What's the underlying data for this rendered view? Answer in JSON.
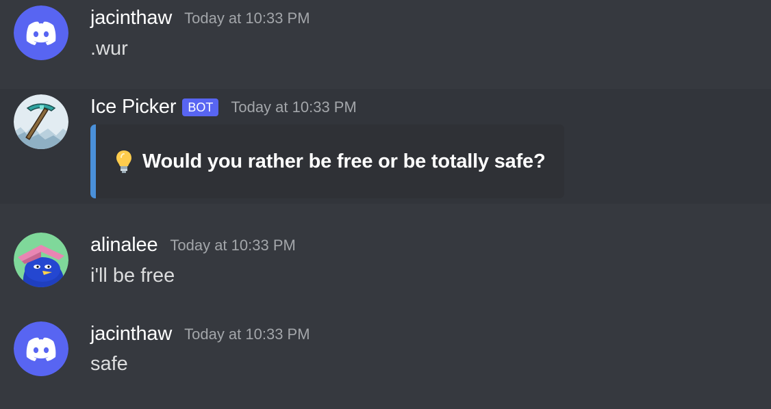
{
  "messages": [
    {
      "username": "jacinthaw",
      "timestamp": "Today at 10:33 PM",
      "avatar": "discord-logo-icon",
      "text": ".wur"
    },
    {
      "username": "Ice Picker",
      "tag": "BOT",
      "timestamp": "Today at 10:33 PM",
      "avatar": "pickaxe-icon",
      "embed": {
        "icon": "lightbulb-icon",
        "title": "Would you rather be free or be totally safe?",
        "color": "#4a90d9"
      }
    },
    {
      "username": "alinalee",
      "timestamp": "Today at 10:33 PM",
      "avatar": "cartoon-character-avatar",
      "text": "i'll be free"
    },
    {
      "username": "jacinthaw",
      "timestamp": "Today at 10:33 PM",
      "avatar": "discord-logo-icon",
      "text": "safe"
    }
  ],
  "colors": {
    "background": "#36393f",
    "highlight": "#32353b",
    "discord_blurple": "#5865f2",
    "username": "#ffffff",
    "timestamp": "#a3a6aa",
    "message_text": "#dcddde",
    "embed_background": "#2f3136"
  }
}
